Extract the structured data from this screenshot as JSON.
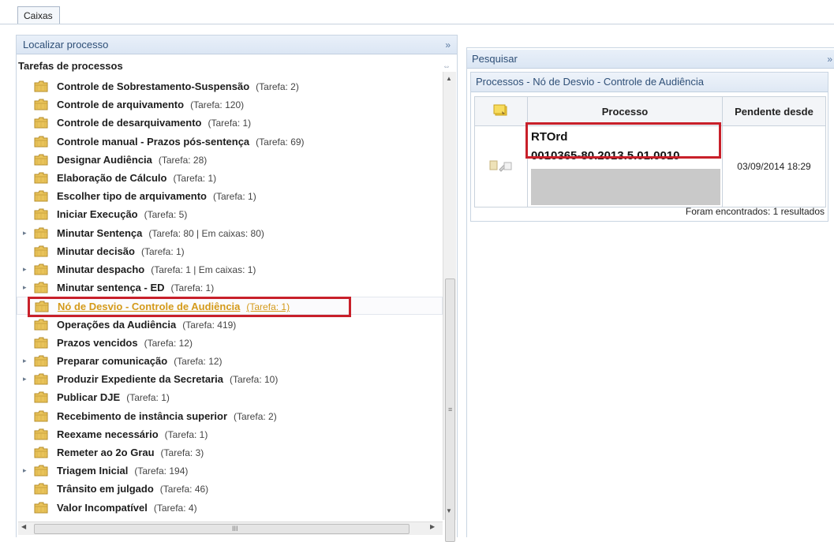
{
  "tab": {
    "label": "Caixas"
  },
  "left": {
    "header": "Localizar processo",
    "collapse_glyph": "»",
    "tree_title": "Tarefas de processos",
    "items": [
      {
        "label": "Controle de Sobrestamento-Suspensão",
        "count": "(Tarefa: 2)",
        "expandable": false
      },
      {
        "label": "Controle de arquivamento",
        "count": "(Tarefa: 120)",
        "expandable": false
      },
      {
        "label": "Controle de desarquivamento",
        "count": "(Tarefa: 1)",
        "expandable": false
      },
      {
        "label": "Controle manual - Prazos pós-sentença",
        "count": "(Tarefa: 69)",
        "expandable": false
      },
      {
        "label": "Designar Audiência",
        "count": "(Tarefa: 28)",
        "expandable": false
      },
      {
        "label": "Elaboração de Cálculo",
        "count": "(Tarefa: 1)",
        "expandable": false
      },
      {
        "label": "Escolher tipo de arquivamento",
        "count": "(Tarefa: 1)",
        "expandable": false
      },
      {
        "label": "Iniciar Execução",
        "count": "(Tarefa: 5)",
        "expandable": false
      },
      {
        "label": "Minutar Sentença",
        "count": "(Tarefa: 80 | Em caixas: 80)",
        "expandable": true
      },
      {
        "label": "Minutar decisão",
        "count": "(Tarefa: 1)",
        "expandable": false
      },
      {
        "label": "Minutar despacho",
        "count": "(Tarefa: 1 | Em caixas: 1)",
        "expandable": true
      },
      {
        "label": "Minutar sentença - ED",
        "count": "(Tarefa: 1)",
        "expandable": true
      },
      {
        "label": "Nó de Desvio - Controle de Audiência",
        "count": "(Tarefa: 1)",
        "expandable": false,
        "selected": true
      },
      {
        "label": "Operações da Audiência",
        "count": "(Tarefa: 419)",
        "expandable": false
      },
      {
        "label": "Prazos vencidos",
        "count": "(Tarefa: 12)",
        "expandable": false
      },
      {
        "label": "Preparar comunicação",
        "count": "(Tarefa: 12)",
        "expandable": true
      },
      {
        "label": "Produzir Expediente da Secretaria",
        "count": "(Tarefa: 10)",
        "expandable": true
      },
      {
        "label": "Publicar DJE",
        "count": "(Tarefa: 1)",
        "expandable": false
      },
      {
        "label": "Recebimento de instância superior",
        "count": "(Tarefa: 2)",
        "expandable": false
      },
      {
        "label": "Reexame necessário",
        "count": "(Tarefa: 1)",
        "expandable": false
      },
      {
        "label": "Remeter ao 2o Grau",
        "count": "(Tarefa: 3)",
        "expandable": false
      },
      {
        "label": "Triagem Inicial",
        "count": "(Tarefa: 194)",
        "expandable": true
      },
      {
        "label": "Trânsito em julgado",
        "count": "(Tarefa: 46)",
        "expandable": false
      },
      {
        "label": "Valor Incompatível",
        "count": "(Tarefa: 4)",
        "expandable": false
      }
    ],
    "hscroll_grip": "III",
    "vscroll_grip": "≡"
  },
  "right": {
    "header": "Pesquisar",
    "collapse_glyph": "»",
    "panel_title": "Processos - Nó de Desvio - Controle de Audiência",
    "columns": [
      "Processo",
      "Pendente desde"
    ],
    "row": {
      "processo_line1": "RTOrd",
      "processo_line2": "0010365-80.2013.5.01.0010",
      "pendente_desde": "03/09/2014 18:29"
    },
    "footer": "Foram encontrados: 1 resultados"
  },
  "colors": {
    "highlight": "#c8202a",
    "selected_text": "#d49a1a",
    "header_text": "#2e4f77"
  }
}
